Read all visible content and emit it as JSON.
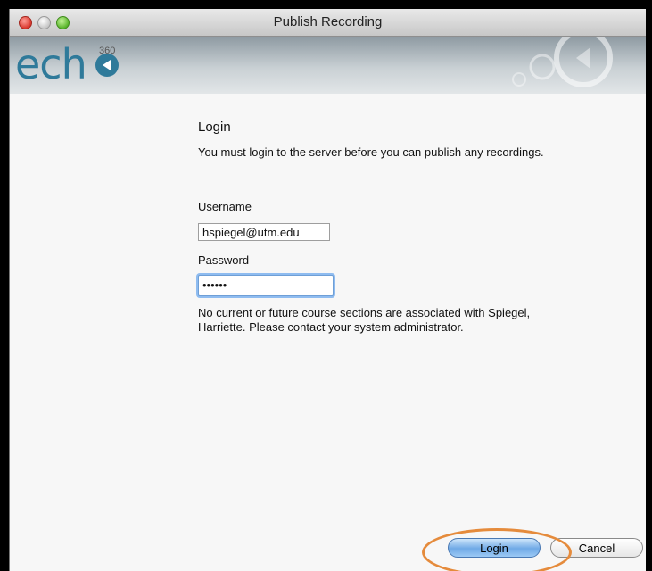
{
  "window": {
    "title": "Publish Recording"
  },
  "branding": {
    "logo_text": "ech",
    "logo_superscript": "360",
    "accent": "#2f7a9a"
  },
  "login": {
    "heading": "Login",
    "intro": "You must login to the server before you can publish any recordings.",
    "username_label": "Username",
    "username_value": "hspiegel@utm.edu",
    "password_label": "Password",
    "password_value": "••••••",
    "error_message": "No current or future course sections are associated with Spiegel, Harriette. Please contact your system administrator."
  },
  "buttons": {
    "login_label": "Login",
    "cancel_label": "Cancel"
  },
  "annotation": {
    "highlight_color": "#e58b3c"
  }
}
